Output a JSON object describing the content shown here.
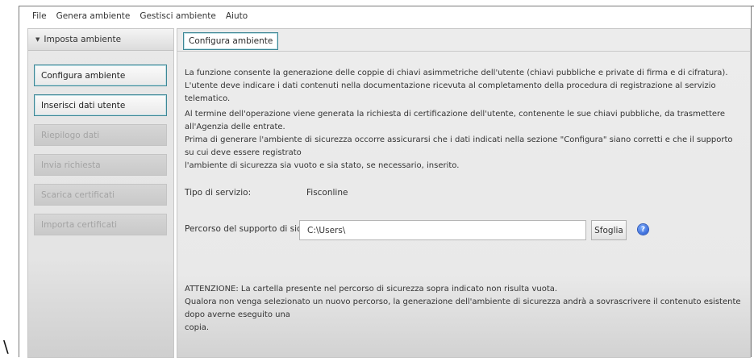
{
  "menu": [
    "File",
    "Genera ambiente",
    "Gestisci ambiente",
    "Aiuto"
  ],
  "sidebar": {
    "header": "Imposta ambiente",
    "items": [
      {
        "label": "Configura ambiente",
        "state": "active"
      },
      {
        "label": "Inserisci dati utente",
        "state": "active"
      },
      {
        "label": "Riepilogo dati",
        "state": "disabled"
      },
      {
        "label": "Invia richiesta",
        "state": "disabled"
      },
      {
        "label": "Scarica certificati",
        "state": "disabled"
      },
      {
        "label": "Importa certificati",
        "state": "disabled"
      }
    ]
  },
  "main": {
    "tab": "Configura ambiente",
    "intro_line1": "La funzione consente la generazione delle coppie di chiavi asimmetriche dell'utente (chiavi pubbliche e private di firma e di cifratura).",
    "intro_line2": "L'utente deve indicare i dati contenuti nella documentazione ricevuta al completamento della procedura di registrazione al servizio telematico.",
    "info_line1": "Al termine dell'operazione viene generata la richiesta di certificazione dell'utente, contenente le sue chiavi pubbliche, da trasmettere all'Agenzia delle entrate.",
    "info_line2": "Prima di generare l'ambiente di sicurezza occorre assicurarsi che i dati indicati nella sezione \"Configura\" siano corretti e che il supporto su cui deve essere registrato",
    "info_line3": "l'ambiente di sicurezza sia vuoto e sia stato, se necessario, inserito.",
    "service_label": "Tipo di servizio:",
    "service_value": "Fisconline",
    "path_label": "Percorso del supporto di sicur...",
    "path_value": "C:\\Users\\",
    "browse_label": "Sfoglia",
    "help_icon": "help-icon",
    "warning_line1": "ATTENZIONE: La cartella presente nel percorso di sicurezza sopra indicato non risulta vuota.",
    "warning_line2": "Qualora non venga selezionato un nuovo percorso, la generazione dell'ambiente di sicurezza andrà a sovrascrivere il contenuto esistente dopo averne eseguito una",
    "warning_line3": "copia."
  },
  "stray_char": "\\",
  "colors": {
    "accent_border": "#3e8796",
    "panel_bg": "#e9e9e9",
    "disabled_text": "#a3a3a3"
  }
}
